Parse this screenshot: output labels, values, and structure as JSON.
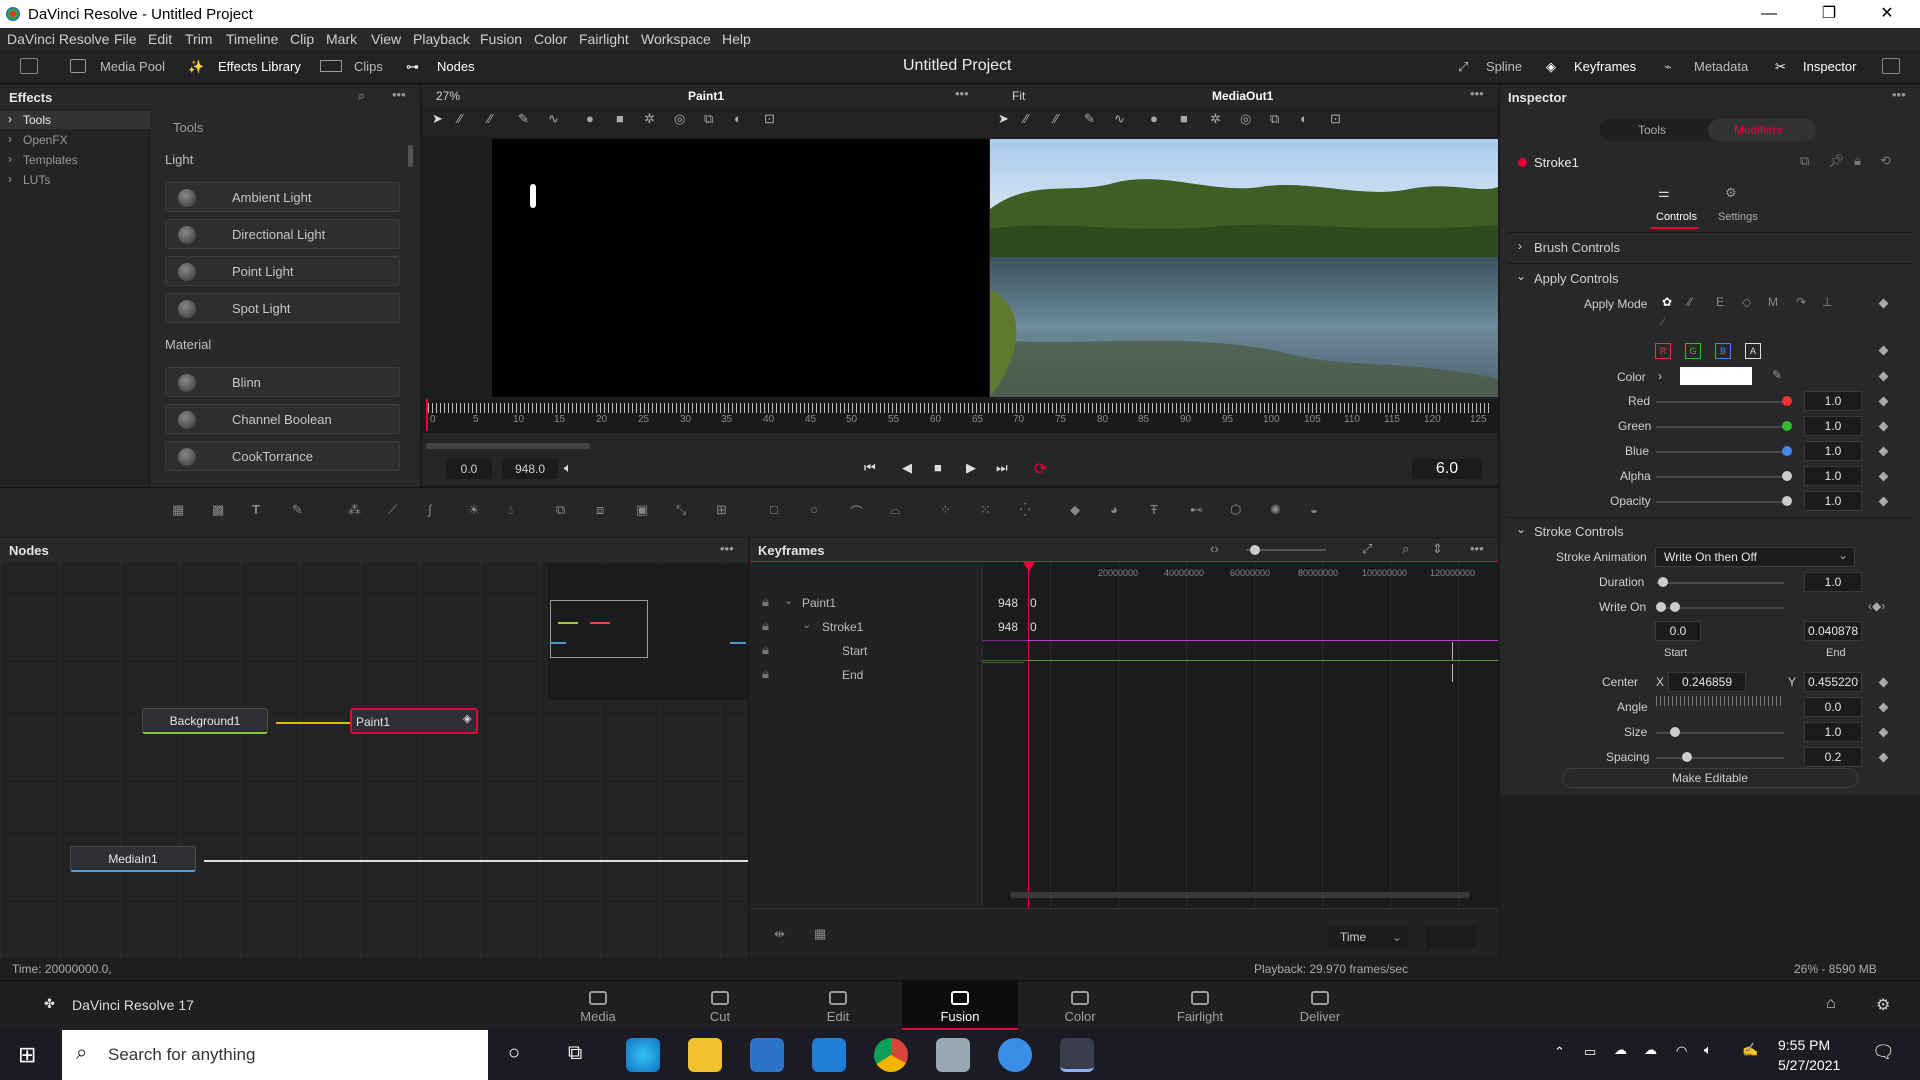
{
  "window": {
    "title": "DaVinci Resolve - Untitled Project",
    "minimize": "—",
    "maximize": "❐",
    "close": "✕"
  },
  "menu": [
    "DaVinci Resolve",
    "File",
    "Edit",
    "Trim",
    "Timeline",
    "Clip",
    "Mark",
    "View",
    "Playback",
    "Fusion",
    "Color",
    "Fairlight",
    "Workspace",
    "Help"
  ],
  "toolbar": {
    "media_pool": "Media Pool",
    "effects_library": "Effects Library",
    "clips": "Clips",
    "nodes": "Nodes",
    "project_title": "Untitled Project",
    "spline": "Spline",
    "keyframes": "Keyframes",
    "metadata": "Metadata",
    "inspector": "Inspector"
  },
  "effects": {
    "title": "Effects",
    "tree": [
      "Tools",
      "OpenFX",
      "Templates",
      "LUTs"
    ],
    "tools_header": "Tools",
    "light_section": "Light",
    "light_items": [
      "Ambient Light",
      "Directional Light",
      "Point Light",
      "Spot Light"
    ],
    "material_section": "Material",
    "material_items": [
      "Blinn",
      "Channel Boolean",
      "CookTorrance"
    ]
  },
  "viewer": {
    "zoom_left": "27%",
    "left_label": "Paint1",
    "fit": "Fit",
    "right_label": "MediaOut1",
    "time_start": "0.0",
    "time_end": "948.0",
    "current_frame": "6.0",
    "ruler": [
      "0",
      "5",
      "10",
      "15",
      "20",
      "25",
      "30",
      "35",
      "40",
      "45",
      "50",
      "55",
      "60",
      "65",
      "70",
      "75",
      "80",
      "85",
      "90",
      "95",
      "100",
      "105",
      "110",
      "115",
      "120",
      "125"
    ]
  },
  "nodes": {
    "title": "Nodes",
    "background": "Background1",
    "paint": "Paint1",
    "media_in": "MediaIn1"
  },
  "keyframes": {
    "title": "Keyframes",
    "rows": [
      {
        "name": "Paint1",
        "val": "948",
        "val2": "0"
      },
      {
        "name": "Stroke1",
        "val": "948",
        "val2": "0"
      },
      {
        "name": "Start",
        "val": "",
        "val2": ""
      },
      {
        "name": "End",
        "val": "",
        "val2": ""
      }
    ],
    "ruler": [
      "20000000",
      "40000000",
      "60000000",
      "80000000",
      "100000000",
      "120000000"
    ],
    "time_select": "Time"
  },
  "inspector": {
    "title": "Inspector",
    "tab_tools": "Tools",
    "tab_modifiers": "Modifiers",
    "node": "Stroke1",
    "sub_controls": "Controls",
    "sub_settings": "Settings",
    "brush_controls": "Brush Controls",
    "apply_controls": "Apply Controls",
    "apply_mode": "Apply Mode",
    "channels": [
      "R",
      "G",
      "B",
      "A"
    ],
    "color": "Color",
    "red": "Red",
    "red_v": "1.0",
    "green": "Green",
    "green_v": "1.0",
    "blue": "Blue",
    "blue_v": "1.0",
    "alpha": "Alpha",
    "alpha_v": "1.0",
    "opacity": "Opacity",
    "opacity_v": "1.0",
    "stroke_controls": "Stroke Controls",
    "stroke_animation": "Stroke Animation",
    "stroke_animation_v": "Write On then Off",
    "duration": "Duration",
    "duration_v": "1.0",
    "write_on": "Write On",
    "write_start_v": "0.0",
    "write_end_v": "0.040878",
    "start": "Start",
    "end": "End",
    "center": "Center",
    "cx_label": "X",
    "cx": "0.246859",
    "cy_label": "Y",
    "cy": "0.455220",
    "angle": "Angle",
    "angle_v": "0.0",
    "size": "Size",
    "size_v": "1.0",
    "spacing": "Spacing",
    "spacing_v": "0.2",
    "make_editable": "Make Editable"
  },
  "status": {
    "time": "Time: 20000000.0,",
    "playback": "Playback: 29.970 frames/sec",
    "memory": "26% - 8590 MB"
  },
  "pages": {
    "brand": "DaVinci Resolve 17",
    "items": [
      "Media",
      "Cut",
      "Edit",
      "Fusion",
      "Color",
      "Fairlight",
      "Deliver"
    ],
    "active": "Fusion"
  },
  "taskbar": {
    "search_placeholder": "Search for anything",
    "time": "9:55 PM",
    "date": "5/27/2021"
  },
  "colors": {
    "accent": "#e8003d",
    "selection": "#e8003d"
  }
}
